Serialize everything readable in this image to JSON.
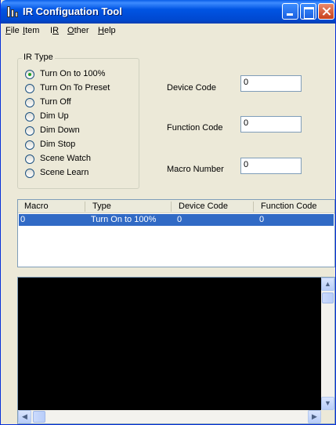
{
  "window": {
    "title": "IR Configuation Tool"
  },
  "menu": [
    {
      "pre": "",
      "u": "F",
      "post": "ile"
    },
    {
      "pre": "",
      "u": "I",
      "post": "tem"
    },
    {
      "pre": "I",
      "u": "R",
      "post": ""
    },
    {
      "pre": "",
      "u": "O",
      "post": "ther"
    },
    {
      "pre": "",
      "u": "H",
      "post": "elp"
    }
  ],
  "ir_type": {
    "label": "IR Type",
    "options": [
      {
        "label": "Turn On to 100%",
        "selected": true
      },
      {
        "label": "Turn On To Preset",
        "selected": false
      },
      {
        "label": "Turn Off",
        "selected": false
      },
      {
        "label": "Dim Up",
        "selected": false
      },
      {
        "label": "Dim Down",
        "selected": false
      },
      {
        "label": "Dim Stop",
        "selected": false
      },
      {
        "label": "Scene Watch",
        "selected": false
      },
      {
        "label": "Scene Learn",
        "selected": false
      }
    ]
  },
  "fields": {
    "device_code": {
      "label": "Device Code",
      "value": "0"
    },
    "function_code": {
      "label": "Function Code",
      "value": "0"
    },
    "macro_number": {
      "label": "Macro Number",
      "value": "0"
    }
  },
  "table": {
    "columns": [
      "Macro",
      "Type",
      "Device Code",
      "Function Code"
    ],
    "rows": [
      [
        "0",
        "Turn On to 100%",
        "0",
        "0"
      ]
    ]
  },
  "colors": {
    "titlebar": "#0054e3",
    "selection": "#316ac5",
    "console_bg": "#000000",
    "window_bg": "#ece9d8"
  },
  "icons": {
    "app": "ir-tool-icon",
    "minimize": "minimize-icon",
    "maximize": "maximize-icon",
    "close": "close-icon",
    "scroll_up": "arrow-up-icon",
    "scroll_down": "arrow-down-icon",
    "scroll_left": "arrow-left-icon",
    "scroll_right": "arrow-right-icon"
  }
}
